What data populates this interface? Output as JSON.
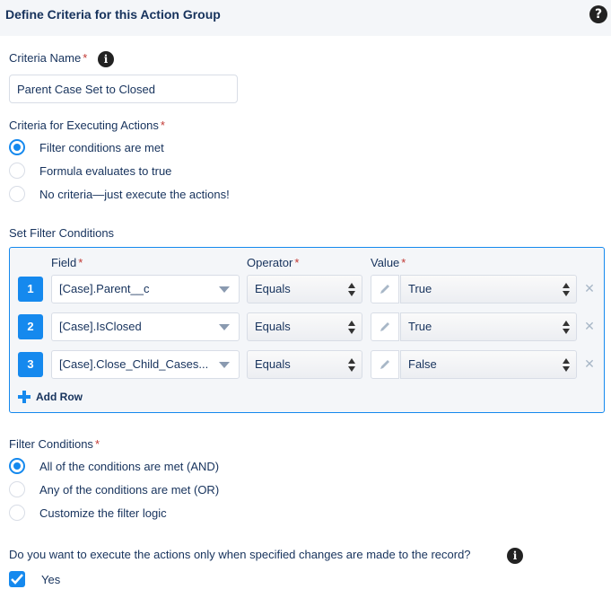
{
  "header": {
    "title": "Define Criteria for this Action Group",
    "help_icon": "question-circle-icon"
  },
  "criteria_name": {
    "label": "Criteria Name",
    "required": "*",
    "value": "Parent Case Set to Closed",
    "info_icon": "info-icon"
  },
  "executing": {
    "label": "Criteria for Executing Actions",
    "required": "*",
    "options": [
      {
        "label": "Filter conditions are met",
        "checked": true
      },
      {
        "label": "Formula evaluates to true",
        "checked": false
      },
      {
        "label": "No criteria—just execute the actions!",
        "checked": false
      }
    ]
  },
  "filter_section": {
    "label": "Set Filter Conditions",
    "columns": {
      "field": "Field",
      "operator": "Operator",
      "value": "Value",
      "required": "*"
    },
    "rows": [
      {
        "num": "1",
        "field": "[Case].Parent__c",
        "operator": "Equals",
        "value": "True"
      },
      {
        "num": "2",
        "field": "[Case].IsClosed",
        "operator": "Equals",
        "value": "True"
      },
      {
        "num": "3",
        "field": "[Case].Close_Child_Cases...",
        "operator": "Equals",
        "value": "False"
      }
    ],
    "add_row_label": "Add Row"
  },
  "filter_conditions": {
    "label": "Filter Conditions",
    "required": "*",
    "options": [
      {
        "label": "All of the conditions are met (AND)",
        "checked": true
      },
      {
        "label": "Any of the conditions are met (OR)",
        "checked": false
      },
      {
        "label": "Customize the filter logic",
        "checked": false
      }
    ]
  },
  "changes_question": {
    "label": "Do you want to execute the actions only when specified changes are made to the record?",
    "info_icon": "info-icon"
  },
  "yes_checkbox": {
    "label": "Yes",
    "checked": true
  },
  "colors": {
    "accent": "#1589ee",
    "text": "#16325c",
    "required": "#c23934"
  }
}
